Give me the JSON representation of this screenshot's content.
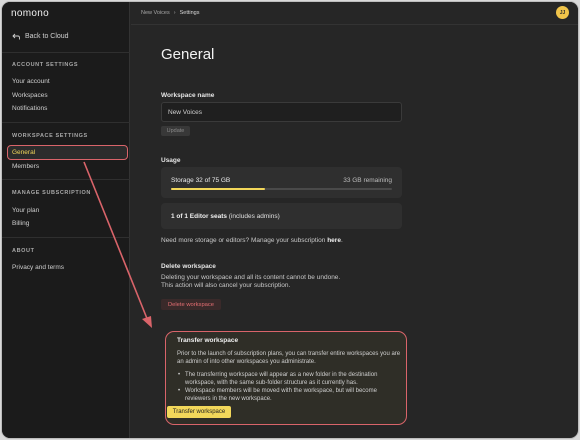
{
  "app": {
    "logo": "nomono"
  },
  "sidebar": {
    "back_label": "Back to Cloud",
    "sections": [
      {
        "title": "ACCOUNT SETTINGS",
        "items": [
          "Your account",
          "Workspaces",
          "Notifications"
        ]
      },
      {
        "title": "WORKSPACE SETTINGS",
        "items": [
          "General",
          "Members"
        ]
      },
      {
        "title": "MANAGE SUBSCRIPTION",
        "items": [
          "Your plan",
          "Billing"
        ]
      },
      {
        "title": "ABOUT",
        "items": [
          "Privacy and terms"
        ]
      }
    ],
    "active_item": "General"
  },
  "topbar": {
    "breadcrumb": [
      "New Voices",
      "Settings"
    ],
    "avatar_initials": "JJ"
  },
  "main": {
    "title": "General",
    "workspace_name_label": "Workspace name",
    "workspace_name_value": "New Voices",
    "update_label": "Update",
    "usage_label": "Usage",
    "storage_label": "Storage 32 of 75 GB",
    "storage_remaining": "33 GB remaining",
    "storage_used_fraction": 0.4267,
    "seats_bold": "1 of 1 Editor seats",
    "seats_rest": " (includes admins)",
    "more_storage_text": "Need more storage or editors? Manage your subscription ",
    "more_storage_link": "here",
    "more_storage_end": ".",
    "delete_label": "Delete workspace",
    "delete_desc_1": "Deleting your workspace and all its content cannot be undone.",
    "delete_desc_2": "This action will also cancel your subscription.",
    "delete_button": "Delete workspace",
    "transfer": {
      "title": "Transfer workspace",
      "description": "Prior to the launch of subscription plans, you can transfer entire workspaces you are an admin of into other workspaces you administrate.",
      "bullets": [
        "The transferring workspace will appear as a new folder in the destination workspace, with the same sub-folder structure as it currently has.",
        "Workspace members will be moved with the workspace, but will become reviewers in the new workspace."
      ],
      "button": "Transfer workspace"
    }
  },
  "colors": {
    "accent": "#f2d75a",
    "highlight": "#d9646a",
    "danger": "#e46e72"
  }
}
